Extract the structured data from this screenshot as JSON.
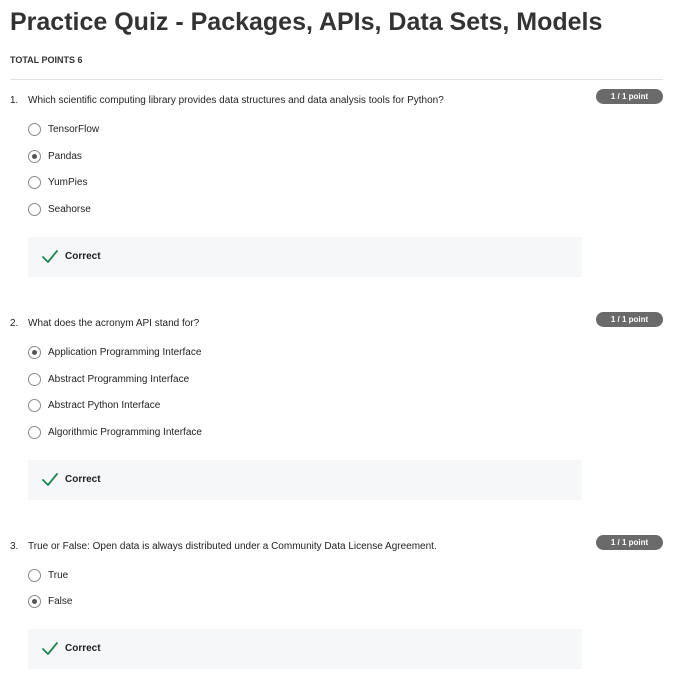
{
  "page": {
    "title": "Practice Quiz - Packages, APIs, Data Sets, Models",
    "total_points": "TOTAL POINTS 6"
  },
  "colors": {
    "correct": "#1f8354",
    "badge": "#6a6a6a"
  },
  "questions": [
    {
      "number": "1.",
      "text": "Which scientific computing library provides data structures and data analysis tools for Python?",
      "points": "1 / 1 point",
      "options": [
        {
          "label": "TensorFlow",
          "selected": false
        },
        {
          "label": "Pandas",
          "selected": true
        },
        {
          "label": "YumPies",
          "selected": false
        },
        {
          "label": "Seahorse",
          "selected": false
        }
      ],
      "feedback": {
        "icon": "check-icon",
        "label": "Correct"
      }
    },
    {
      "number": "2.",
      "text": "What does the acronym API stand for?",
      "points": "1 / 1 point",
      "options": [
        {
          "label": "Application Programming Interface",
          "selected": true
        },
        {
          "label": "Abstract Programming Interface",
          "selected": false
        },
        {
          "label": "Abstract Python Interface",
          "selected": false
        },
        {
          "label": "Algorithmic Programming Interface",
          "selected": false
        }
      ],
      "feedback": {
        "icon": "check-icon",
        "label": "Correct"
      }
    },
    {
      "number": "3.",
      "text": "True or False: Open data is always distributed under a Community Data License Agreement.",
      "points": "1 / 1 point",
      "options": [
        {
          "label": "True",
          "selected": false
        },
        {
          "label": "False",
          "selected": true
        }
      ],
      "feedback": {
        "icon": "check-icon",
        "label": "Correct"
      }
    }
  ]
}
